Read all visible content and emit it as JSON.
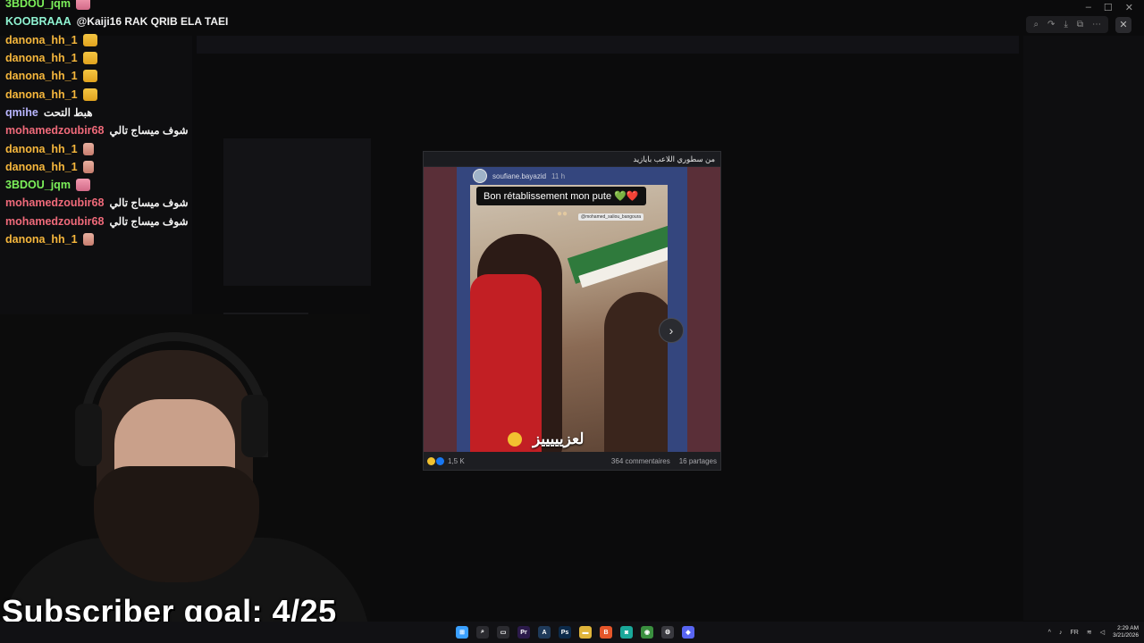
{
  "chat": [
    {
      "user": "3BDOU_jqm",
      "color": "#7cf05a",
      "message": "",
      "emote": "em-pink"
    },
    {
      "user": "KOOBRAAA",
      "color": "#8ff2d1",
      "message": "@Kaiji16 RAK QRIB ELA TAEI",
      "emote": ""
    },
    {
      "user": "danona_hh_1",
      "color": "#f6b73c",
      "message": "",
      "emote": "em-sob"
    },
    {
      "user": "danona_hh_1",
      "color": "#f6b73c",
      "message": "",
      "emote": "em-sob"
    },
    {
      "user": "danona_hh_1",
      "color": "#f6b73c",
      "message": "",
      "emote": "em-sob"
    },
    {
      "user": "danona_hh_1",
      "color": "#f6b73c",
      "message": "",
      "emote": "em-sob"
    },
    {
      "user": "qmihe",
      "color": "#b9b6ff",
      "message": "هبط التحت",
      "emote": ""
    },
    {
      "user": "mohamedzoubir68",
      "color": "#f06a7a",
      "message": "شوف ميساج تالي",
      "emote": ""
    },
    {
      "user": "danona_hh_1",
      "color": "#f6b73c",
      "message": "",
      "emote": "em-pray"
    },
    {
      "user": "danona_hh_1",
      "color": "#f6b73c",
      "message": "",
      "emote": "em-pray"
    },
    {
      "user": "3BDOU_jqm",
      "color": "#7cf05a",
      "message": "",
      "emote": "em-pink"
    },
    {
      "user": "mohamedzoubir68",
      "color": "#f06a7a",
      "message": "شوف ميساج تالي",
      "emote": ""
    },
    {
      "user": "mohamedzoubir68",
      "color": "#f06a7a",
      "message": "شوف ميساج تالي",
      "emote": ""
    },
    {
      "user": "danona_hh_1",
      "color": "#f6b73c",
      "message": "",
      "emote": "em-pray"
    }
  ],
  "post": {
    "caption": "من سطوري اللاعب بايازيد",
    "story_user": "soufiane.bayazid",
    "story_time": "11 h",
    "story_bubble": "Bon rétablissement mon pute 💚❤️",
    "story_tag": "@mohamed_saliou_bangoura",
    "story_overlay_text": "لعزيييييز",
    "reactions_count": "1,5 K",
    "comments": "364 commentaires",
    "shares": "16 partages",
    "next_label": "›"
  },
  "overlay": {
    "subscriber_goal": "Subscriber goal: 4/25"
  },
  "window": {
    "controls": [
      "–",
      "☐",
      "✕"
    ],
    "tools": [
      "⌕",
      "↷",
      "⤓",
      "⧉",
      "⋯"
    ],
    "close": "✕"
  },
  "taskbar": {
    "icons": [
      {
        "name": "start-icon",
        "glyph": "⊞",
        "color": "#3aa0ff"
      },
      {
        "name": "search-icon",
        "glyph": "⌕",
        "color": "#2b2b30"
      },
      {
        "name": "task-view-icon",
        "glyph": "▭",
        "color": "#2b2b30"
      },
      {
        "name": "premiere-icon",
        "glyph": "Pr",
        "color": "#2b1a4a"
      },
      {
        "name": "app-icon",
        "glyph": "A",
        "color": "#1f3a5a"
      },
      {
        "name": "photoshop-icon",
        "glyph": "Ps",
        "color": "#0c2a4a"
      },
      {
        "name": "folder-icon",
        "glyph": "▬",
        "color": "#e0b43a"
      },
      {
        "name": "brave-icon",
        "glyph": "B",
        "color": "#e5562a"
      },
      {
        "name": "app2-icon",
        "glyph": "◙",
        "color": "#1aa89a"
      },
      {
        "name": "chrome-icon",
        "glyph": "◉",
        "color": "#3a8f3f"
      },
      {
        "name": "settings-icon",
        "glyph": "⚙",
        "color": "#3a3a40"
      },
      {
        "name": "discord-icon",
        "glyph": "◆",
        "color": "#5865f2"
      }
    ],
    "tray": {
      "chevron": "^",
      "mic": "♪",
      "language": "FR",
      "wifi": "≋",
      "volume": "◁",
      "time": "2:29 AM",
      "date": "3/21/2026"
    }
  }
}
